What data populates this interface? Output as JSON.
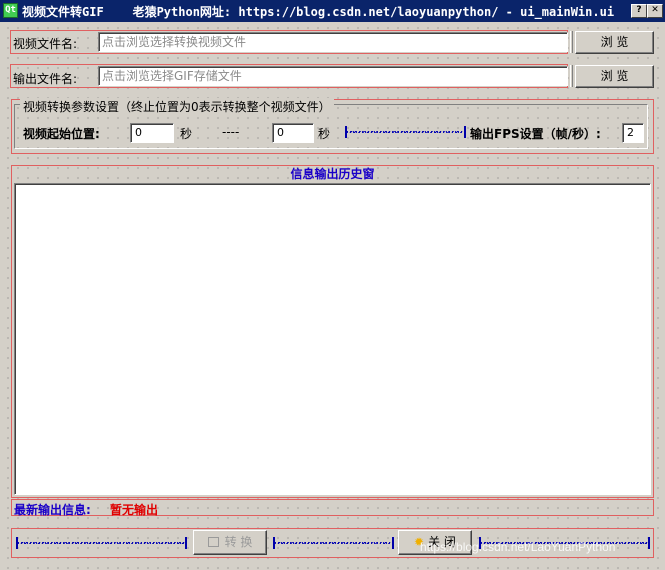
{
  "window": {
    "icon_text": "Qt",
    "title": "视频文件转GIF    老猿Python网址: https://blog.csdn.net/laoyuanpython/ - ui_mainWin.ui",
    "close_glyph": "✕"
  },
  "video_row": {
    "label": "视频文件名:",
    "placeholder": "点击浏览选择转换视频文件",
    "value": "",
    "browse_label": "浏 览"
  },
  "output_row": {
    "label": "输出文件名:",
    "placeholder": "点击浏览选择GIF存储文件",
    "value": "",
    "browse_label": "浏 览"
  },
  "params": {
    "group_title": "视频转换参数设置（终止位置为0表示转换整个视频文件）",
    "start_label": "视频起始位置:",
    "start_value": "0",
    "start_unit": "秒",
    "separator": "----",
    "end_value": "0",
    "end_unit": "秒",
    "fps_label": "输出FPS设置（帧/秒）:",
    "fps_value": "2"
  },
  "history": {
    "title": "信息输出历史窗",
    "content": ""
  },
  "latest": {
    "label": "最新输出信息:",
    "value": "暂无输出"
  },
  "actions": {
    "convert_label": "转 换",
    "close_label": "关 闭"
  },
  "watermark": "https://blog.csdn.net/LaoYuanPython",
  "colors": {
    "titlebar": "#0a246a",
    "window_bg": "#d4d0c8",
    "accent_blue": "#1a00c8",
    "alert_red": "#e00000",
    "frame_red": "#e06060"
  }
}
